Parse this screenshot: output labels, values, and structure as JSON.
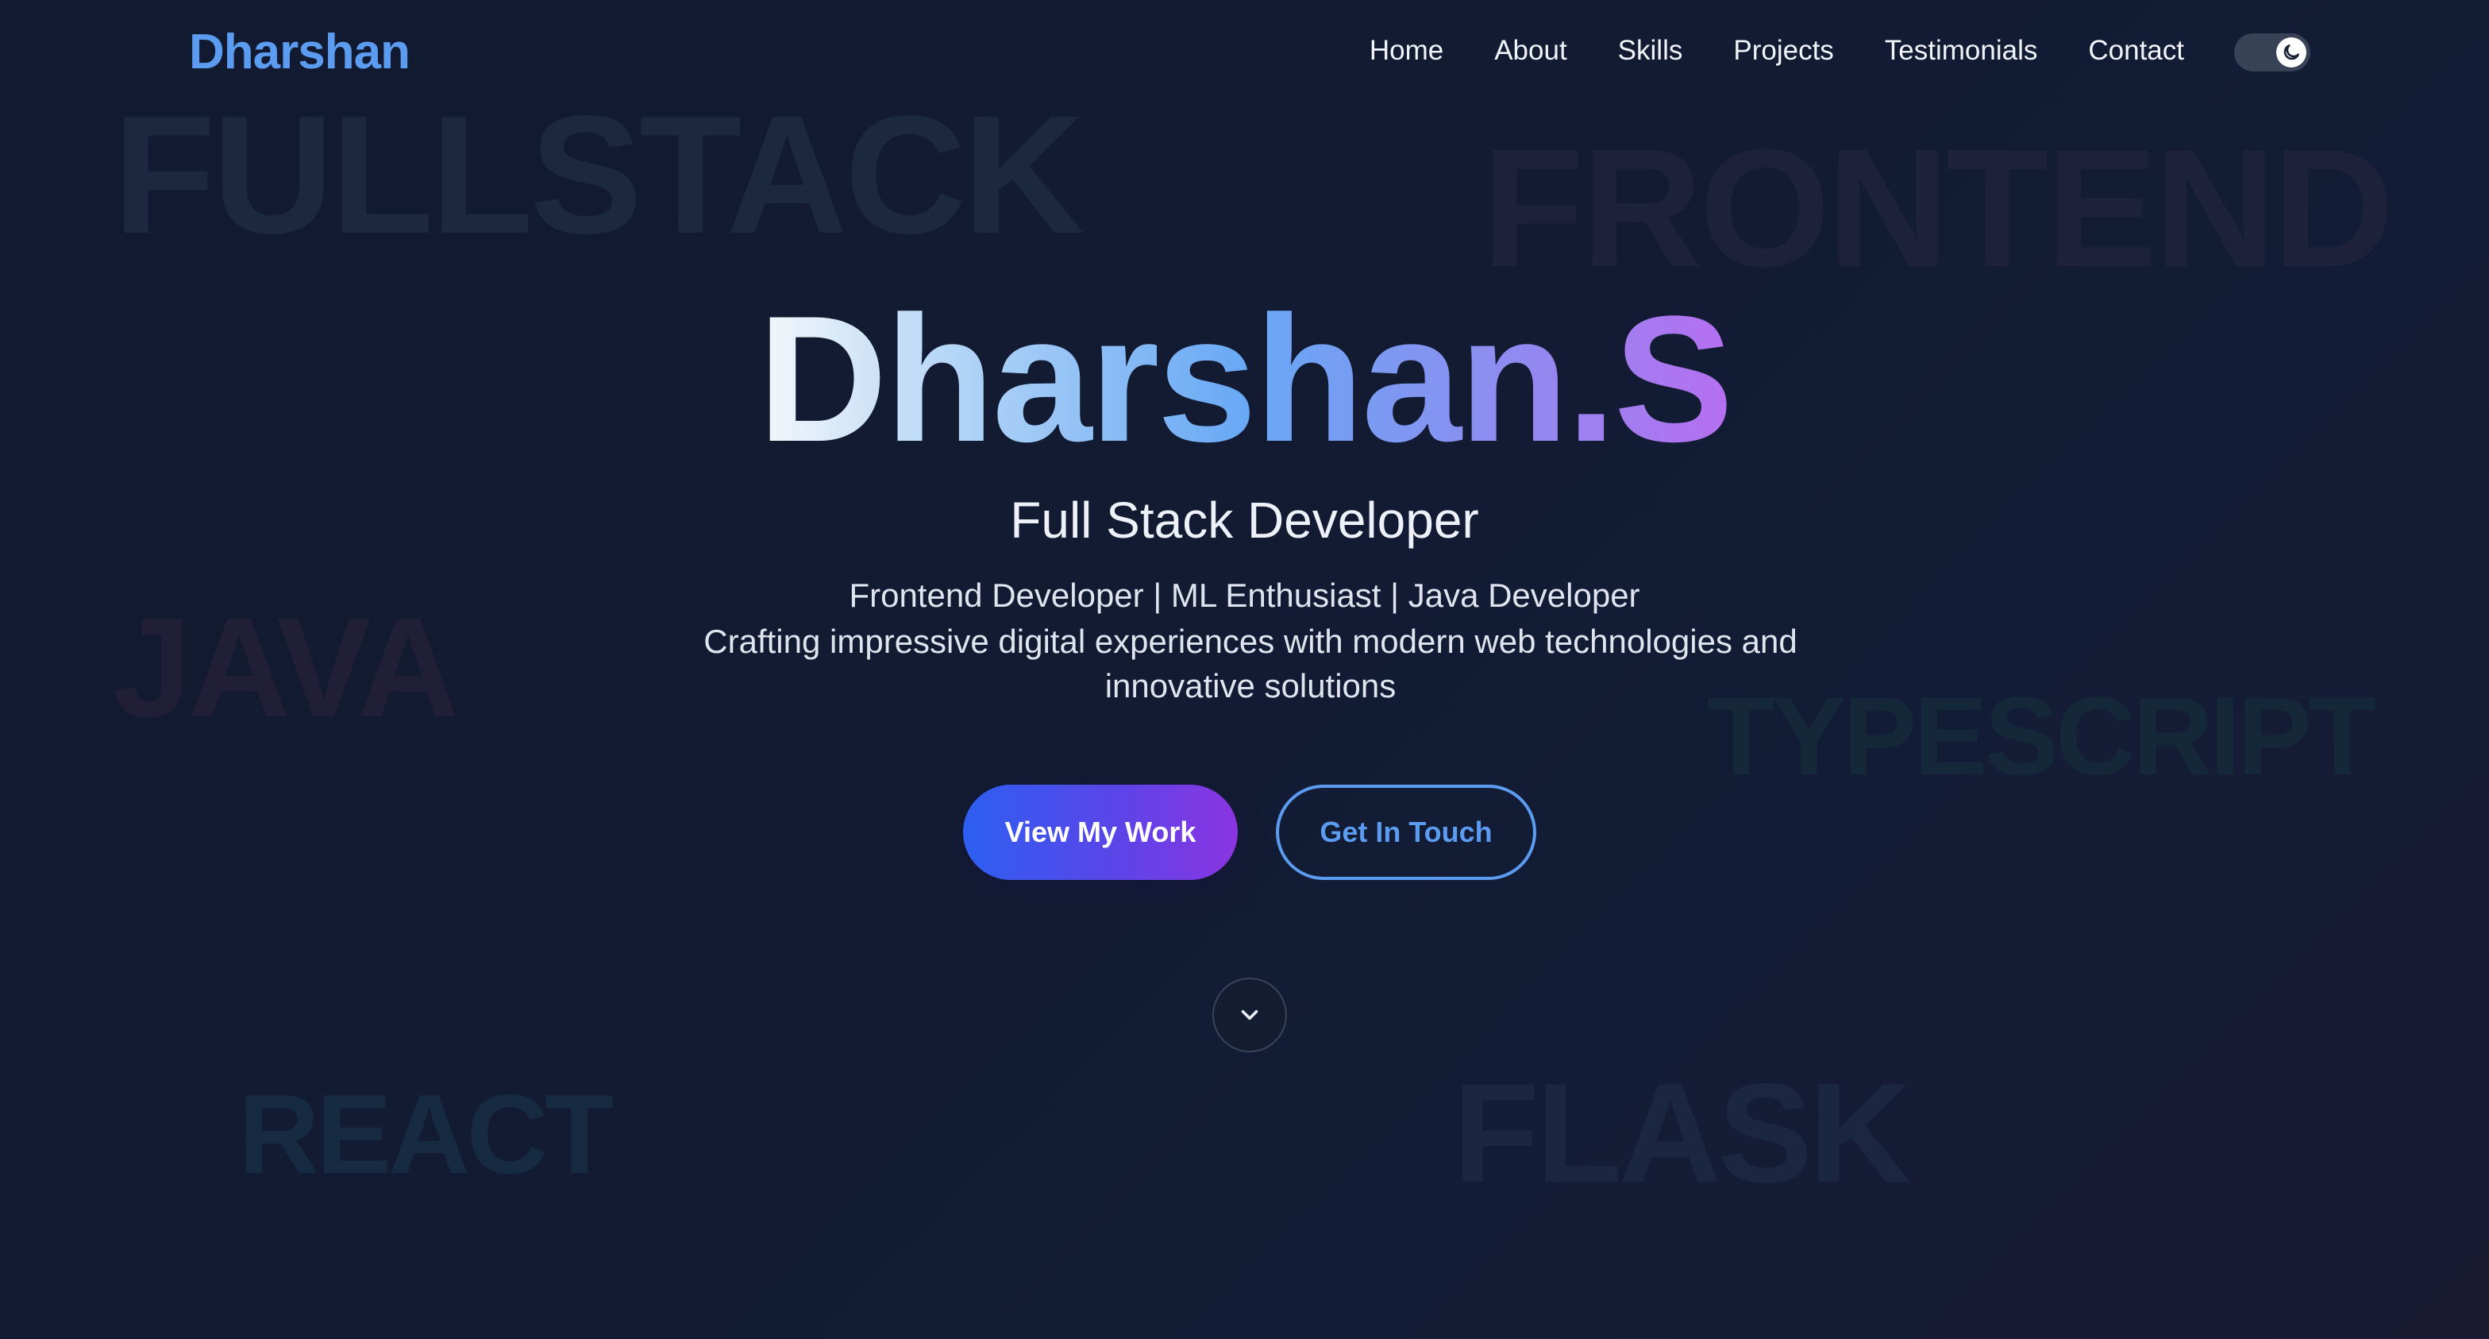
{
  "nav": {
    "logo": "Dharshan",
    "links": [
      "Home",
      "About",
      "Skills",
      "Projects",
      "Testimonials",
      "Contact"
    ],
    "theme_toggle_icon": "moon-icon"
  },
  "background_words": [
    "FULLSTACK",
    "FRONTEND",
    "JAVA",
    "TYPESCRIPT",
    "REACT",
    "FLASK"
  ],
  "hero": {
    "name": "Dharshan.S",
    "title": "Full Stack Developer",
    "subtitle": "Frontend Developer | ML Enthusiast | Java Developer",
    "description": "Crafting impressive digital experiences with modern web technologies and innovative solutions",
    "primary_button": "View My Work",
    "secondary_button": "Get In Touch",
    "scroll_icon": "chevron-down-icon"
  },
  "colors": {
    "accent_blue": "#5b9bf0",
    "gradient_start": "#2d5ff0",
    "gradient_end": "#8b34e2",
    "background": "#121b32"
  }
}
